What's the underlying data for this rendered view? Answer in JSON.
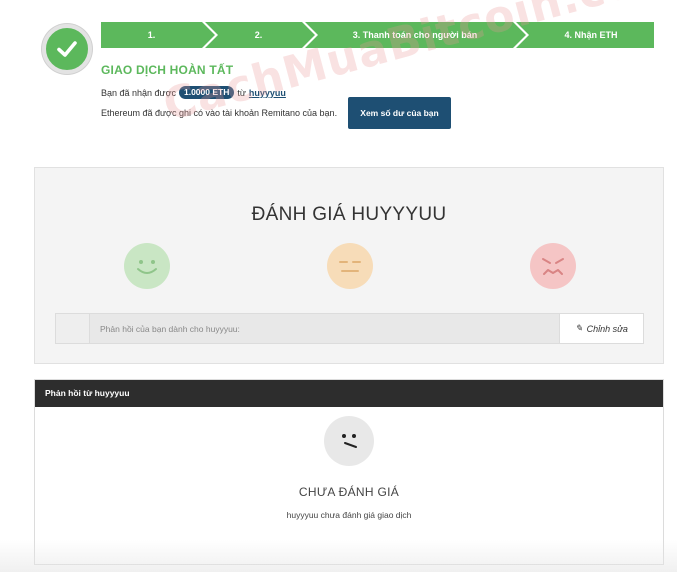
{
  "steps": [
    {
      "label": "1."
    },
    {
      "label": "2."
    },
    {
      "label": "3. Thanh toán cho người bán"
    },
    {
      "label": "4. Nhận ETH"
    }
  ],
  "status": {
    "title": "GIAO DỊCH HOÀN TẤT",
    "received_prefix": "Bạn đã nhận được",
    "amount": "1.0000 ETH",
    "from_word": "từ",
    "seller": "huyyyuu",
    "credited_text": "Ethereum đã được ghi có vào tài khoản Remitano của bạn.",
    "balance_button": "Xem số dư của bạn"
  },
  "watermark": "CachMuaBitcoin.com",
  "rating": {
    "title": "ĐÁNH GIÁ HUYYYUU",
    "faces": [
      "happy-face-icon",
      "neutral-face-icon",
      "sad-face-icon"
    ],
    "feedback_placeholder": "Phản hồi của bạn dành cho huyyyuu:",
    "edit_button": "Chỉnh sửa"
  },
  "from_seller": {
    "header": "Phản hồi từ huyyyuu",
    "status": "CHƯA ĐÁNH GIÁ",
    "subtext": "huyyyuu chưa đánh giá giao dịch"
  },
  "colors": {
    "success": "#5cb85c",
    "primary": "#1e4f73",
    "dark_header": "#2d2d2d"
  }
}
